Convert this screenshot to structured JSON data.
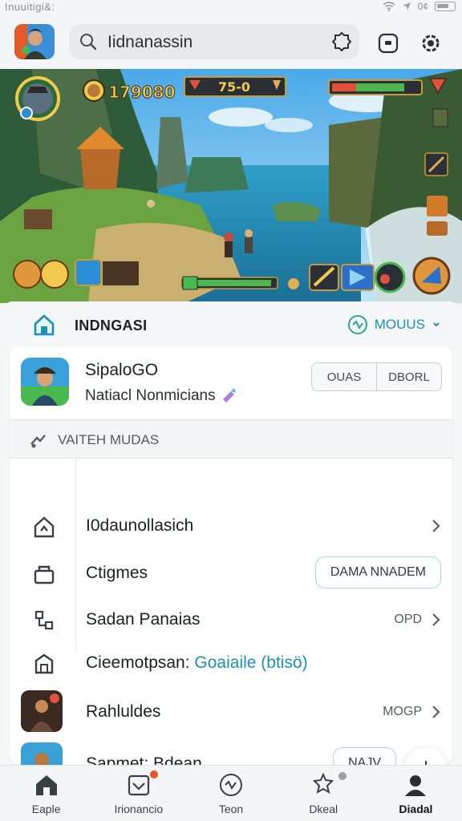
{
  "status_bar": {
    "left": "Inuuitigi&:",
    "right": "0¢"
  },
  "header": {
    "search_value": "Iidnanassin"
  },
  "banner": {
    "hud_score": "179080",
    "hud_timer": "75-0"
  },
  "sheet": {
    "title": "INDNGASI",
    "more_label": "MOUUS"
  },
  "app": {
    "name": "SipaloGO",
    "subtitle": "Natiacl  Nonmicians",
    "seg_left": "OUAS",
    "seg_right": "DBORL"
  },
  "section": {
    "label": "VAITEH MUDAS"
  },
  "rows": [
    {
      "label": "I0daunollasich",
      "meta": "",
      "pill": ""
    },
    {
      "label": "Ctigmes",
      "meta": "",
      "pill": "DAMA NNADEM"
    },
    {
      "label": "Sadan Panaias",
      "meta": "OPD",
      "pill": ""
    },
    {
      "label_main": "Cieemotpsan:",
      "label_accent": "Goaiaile (btisö)"
    },
    {
      "label": "Rahluldes",
      "meta": "MOGP",
      "pill": ""
    },
    {
      "label": "Sapmet: Bdean",
      "meta": "",
      "pill": "NAJV"
    }
  ],
  "bottom_nav": [
    {
      "label": "Eaple",
      "icon": "home-icon"
    },
    {
      "label": "Irionancio",
      "icon": "inbox-icon"
    },
    {
      "label": "Teon",
      "icon": "activity-icon"
    },
    {
      "label": "Dkeal",
      "icon": "puzzle-icon"
    },
    {
      "label": "Diadal",
      "icon": "profile-icon"
    }
  ],
  "colors": {
    "accent": "#1b8fb8",
    "badge": "#e4572e"
  }
}
